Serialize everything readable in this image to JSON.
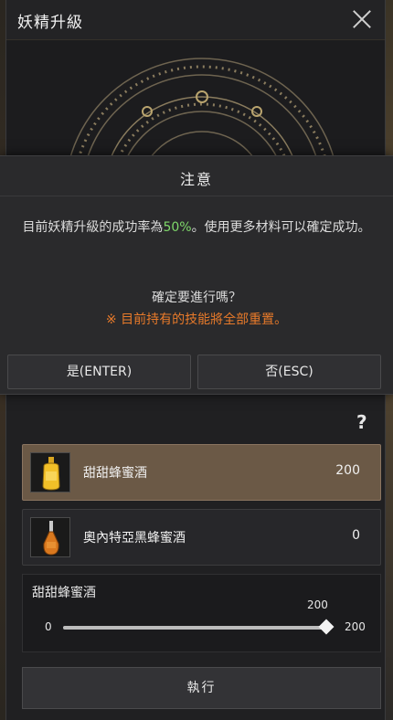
{
  "window": {
    "title": "妖精升級"
  },
  "dialog": {
    "title": "注意",
    "message_prefix": "目前妖精升級的成功率為",
    "success_rate": "50%",
    "message_suffix": "。使用更多材料可以確定成功。",
    "question": "確定要進行嗎？",
    "warning": "※ 目前持有的技能將全部重置。",
    "yes_label": "是(ENTER)",
    "no_label": "否(ESC)"
  },
  "help": {
    "icon": "question-icon",
    "glyph": "?"
  },
  "items": [
    {
      "name": "甜甜蜂蜜酒",
      "count": "200",
      "selected": true,
      "icon": "honey-wine-bottle-icon"
    },
    {
      "name": "奧內特亞黑蜂蜜酒",
      "count": "0",
      "selected": false,
      "icon": "dark-honey-wine-bottle-icon"
    }
  ],
  "slider": {
    "label": "甜甜蜂蜜酒",
    "current": "200",
    "min": "0",
    "max": "200",
    "fraction": 1.0
  },
  "execute_label": "執行",
  "colors": {
    "accent_green": "#7fd86a",
    "warning_orange": "#e87a2a",
    "selected_row": "#6b5946"
  }
}
